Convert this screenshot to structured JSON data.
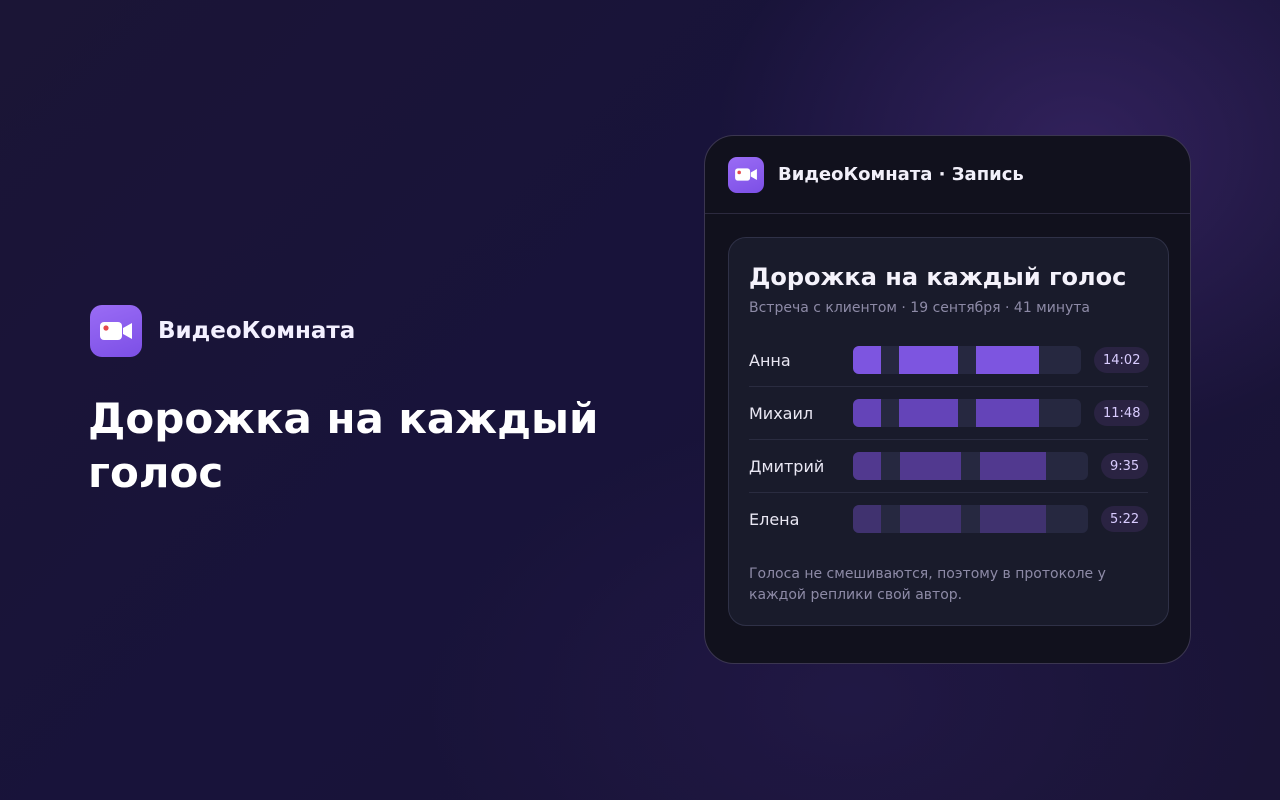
{
  "brand": {
    "name": "ВидеоКомната",
    "icon": "video-camera-icon",
    "accent_color": "#8b5cf6"
  },
  "hero": {
    "title": "Дорожка на каждый голос"
  },
  "card": {
    "header_title": "ВидеоКомната · Запись",
    "panel": {
      "title": "Дорожка на каждый голос",
      "subtitle": "Встреча с клиентом · 19 сентября · 41 минута",
      "tracks": [
        {
          "name": "Анна",
          "duration": "14:02",
          "color": "#7d55e0"
        },
        {
          "name": "Михаил",
          "duration": "11:48",
          "color": "#6444b8"
        },
        {
          "name": "Дмитрий",
          "duration": "9:35",
          "color": "#51398f"
        },
        {
          "name": "Елена",
          "duration": "5:22",
          "color": "#40326f"
        }
      ],
      "note": "Голоса не смешиваются, поэтому в протоколе у каждой реплики свой автор."
    }
  }
}
